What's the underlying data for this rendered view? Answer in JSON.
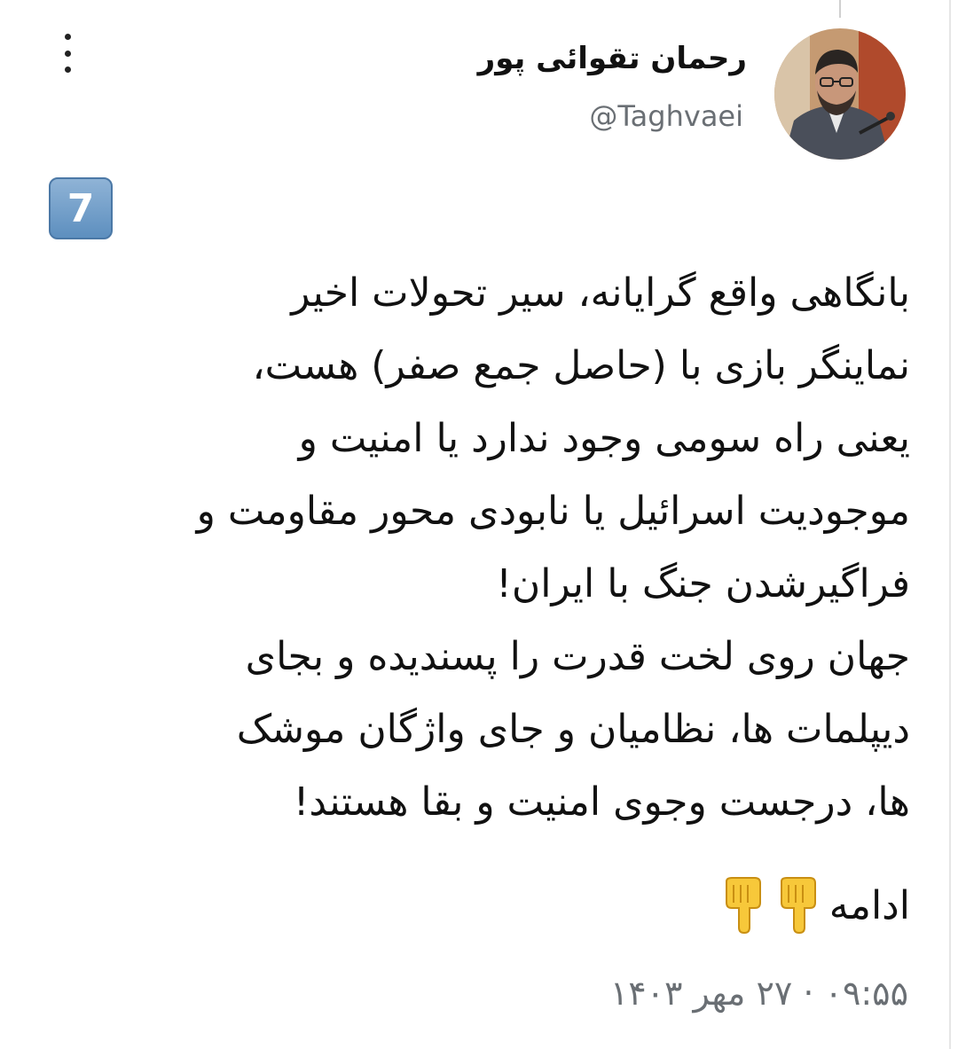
{
  "header": {
    "display_name": "رحمان تقوائی پور",
    "handle": "@Taghvaei"
  },
  "icons": {
    "more": "more-vertical-icon",
    "number_badge": "keycap-digit-seven-icon",
    "pointing": "backhand-index-pointing-down-icon"
  },
  "tweet": {
    "badge": "7",
    "lines": [
      "بانگاهی واقع گرایانه، سیر تحولات اخیر",
      "نماینگر بازی با (حاصل جمع صفر) هست،",
      "یعنی راه سومی وجود ندارد یا امنیت و",
      "موجودیت اسرائیل یا نابودی محور مقاومت و",
      "فراگیرشدن جنگ با ایران!",
      "جهان روی لخت قدرت را پسندیده و بجای",
      "دیپلمات ها، نظامیان و جای واژگان موشک",
      "ها، درجست وجوی امنیت و بقا هستند!"
    ],
    "continue_label": "ادامه"
  },
  "timestamp": "۰۹:۵۵ · ۲۷ مهر ۱۴۰۳",
  "colors": {
    "text": "#111111",
    "secondary": "#6a6f74",
    "keycap": "#6f9bc8",
    "emoji": "#f7c83a"
  }
}
